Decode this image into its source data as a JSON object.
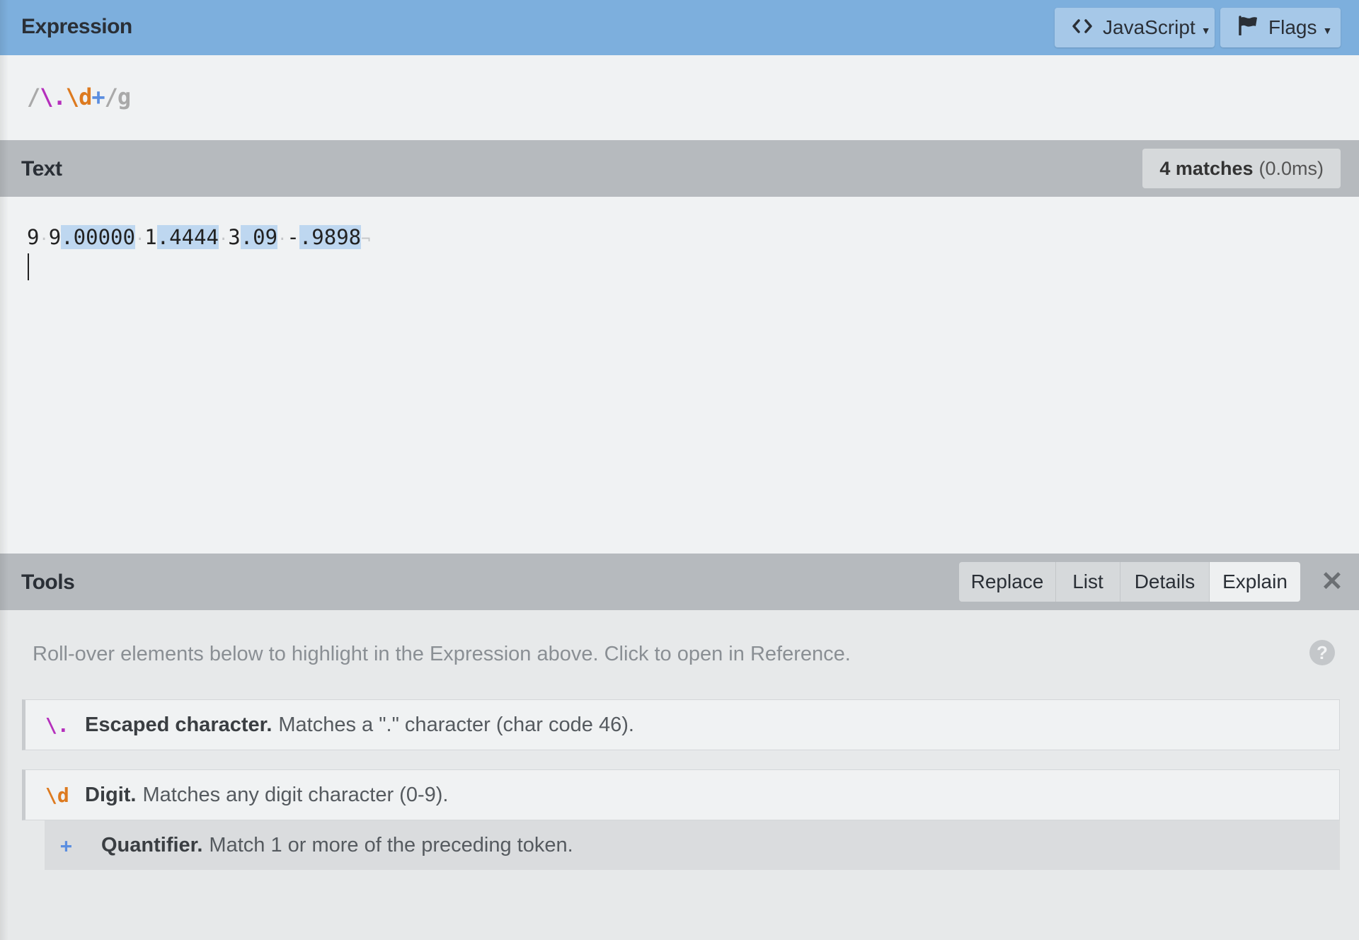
{
  "colors": {
    "header_blue": "#7dafdd",
    "panel_grey": "#b6babe",
    "match_highlight": "#bed7f0",
    "escape_token": "#b52fbc",
    "digit_token": "#dd7a1f",
    "quantifier_token": "#5b8ee0"
  },
  "expression": {
    "title": "Expression",
    "language_button": "JavaScript",
    "language_icon": "code-brackets-icon",
    "flags_button": "Flags",
    "flags_icon": "flag-icon",
    "regex": {
      "open": "/",
      "escape": "\\.",
      "digit": "\\d",
      "quantifier": "+",
      "close": "/",
      "flags": "g"
    }
  },
  "text": {
    "title": "Text",
    "match_count": "4 matches",
    "match_time": "(0.0ms)",
    "test_string": "9 9.00000 1.4444 3.09 -.9898",
    "segments": [
      {
        "t": "9",
        "m": false
      },
      {
        "t": "·",
        "ws": true
      },
      {
        "t": "9",
        "m": false
      },
      {
        "t": ".00000",
        "m": true
      },
      {
        "t": "·",
        "ws": true
      },
      {
        "t": "1",
        "m": false
      },
      {
        "t": ".4444",
        "m": true
      },
      {
        "t": "·",
        "ws": true
      },
      {
        "t": "3",
        "m": false
      },
      {
        "t": ".09",
        "m": true
      },
      {
        "t": "·",
        "ws": true
      },
      {
        "t": "-",
        "m": false
      },
      {
        "t": ".9898",
        "m": true
      },
      {
        "t": "¬",
        "ws": true
      }
    ]
  },
  "tools": {
    "title": "Tools",
    "tabs": [
      {
        "label": "Replace",
        "active": false
      },
      {
        "label": "List",
        "active": false
      },
      {
        "label": "Details",
        "active": false
      },
      {
        "label": "Explain",
        "active": true
      }
    ],
    "close_icon": "close-icon",
    "hint": "Roll-over elements below to highlight in the Expression above. Click to open in Reference.",
    "help_icon": "?",
    "explain": [
      {
        "token": "\\.",
        "name": "Escaped character.",
        "desc": "Matches a \".\" character (char code 46)."
      },
      {
        "token": "\\d",
        "name": "Digit.",
        "desc": "Matches any digit character (0-9)."
      }
    ],
    "quantifier": {
      "token": "+",
      "name": "Quantifier.",
      "desc": "Match 1 or more of the preceding token."
    }
  }
}
